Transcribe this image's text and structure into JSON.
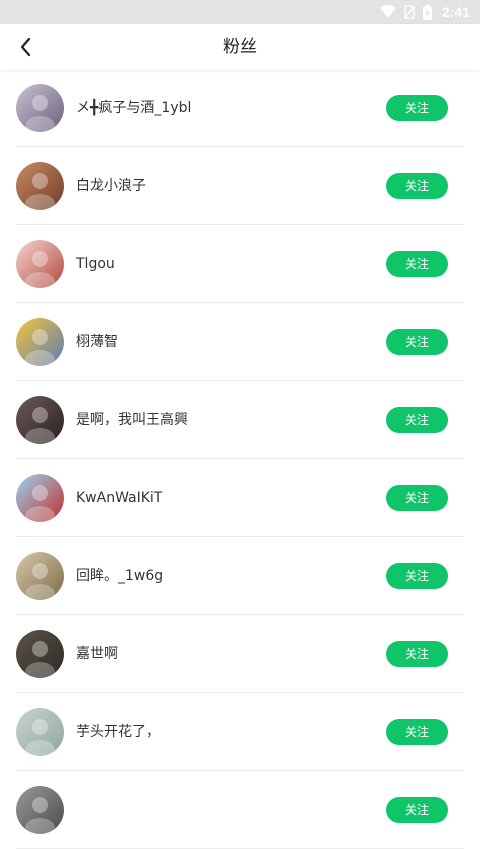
{
  "status_bar": {
    "time": "2:41"
  },
  "header": {
    "title": "粉丝"
  },
  "follow_label": "关注",
  "users": [
    {
      "name": "メ╋疯子与酒_1ybl",
      "avatar_colors": [
        "#c9c2d6",
        "#6b5f7a"
      ]
    },
    {
      "name": "白龙小浪子",
      "avatar_colors": [
        "#c98b63",
        "#6e3b2a"
      ]
    },
    {
      "name": "Tlgou",
      "avatar_colors": [
        "#f3d6d0",
        "#b5473f"
      ]
    },
    {
      "name": "栩薄智",
      "avatar_colors": [
        "#f5c63a",
        "#5a7bb5"
      ]
    },
    {
      "name": "是啊，我叫王高興",
      "avatar_colors": [
        "#6b5a55",
        "#2a2220"
      ]
    },
    {
      "name": "KwAnWaIKiT",
      "avatar_colors": [
        "#9ad3f0",
        "#c0302a"
      ]
    },
    {
      "name": "回眸。_1w6g",
      "avatar_colors": [
        "#d7c9a9",
        "#7b6a4a"
      ]
    },
    {
      "name": "嘉世啊",
      "avatar_colors": [
        "#5b5349",
        "#2e2a24"
      ]
    },
    {
      "name": "芋头开花了，",
      "avatar_colors": [
        "#c9d4cf",
        "#8fa79c"
      ]
    },
    {
      "name": "",
      "avatar_colors": [
        "#9a9a9a",
        "#4a4a4a"
      ]
    }
  ]
}
